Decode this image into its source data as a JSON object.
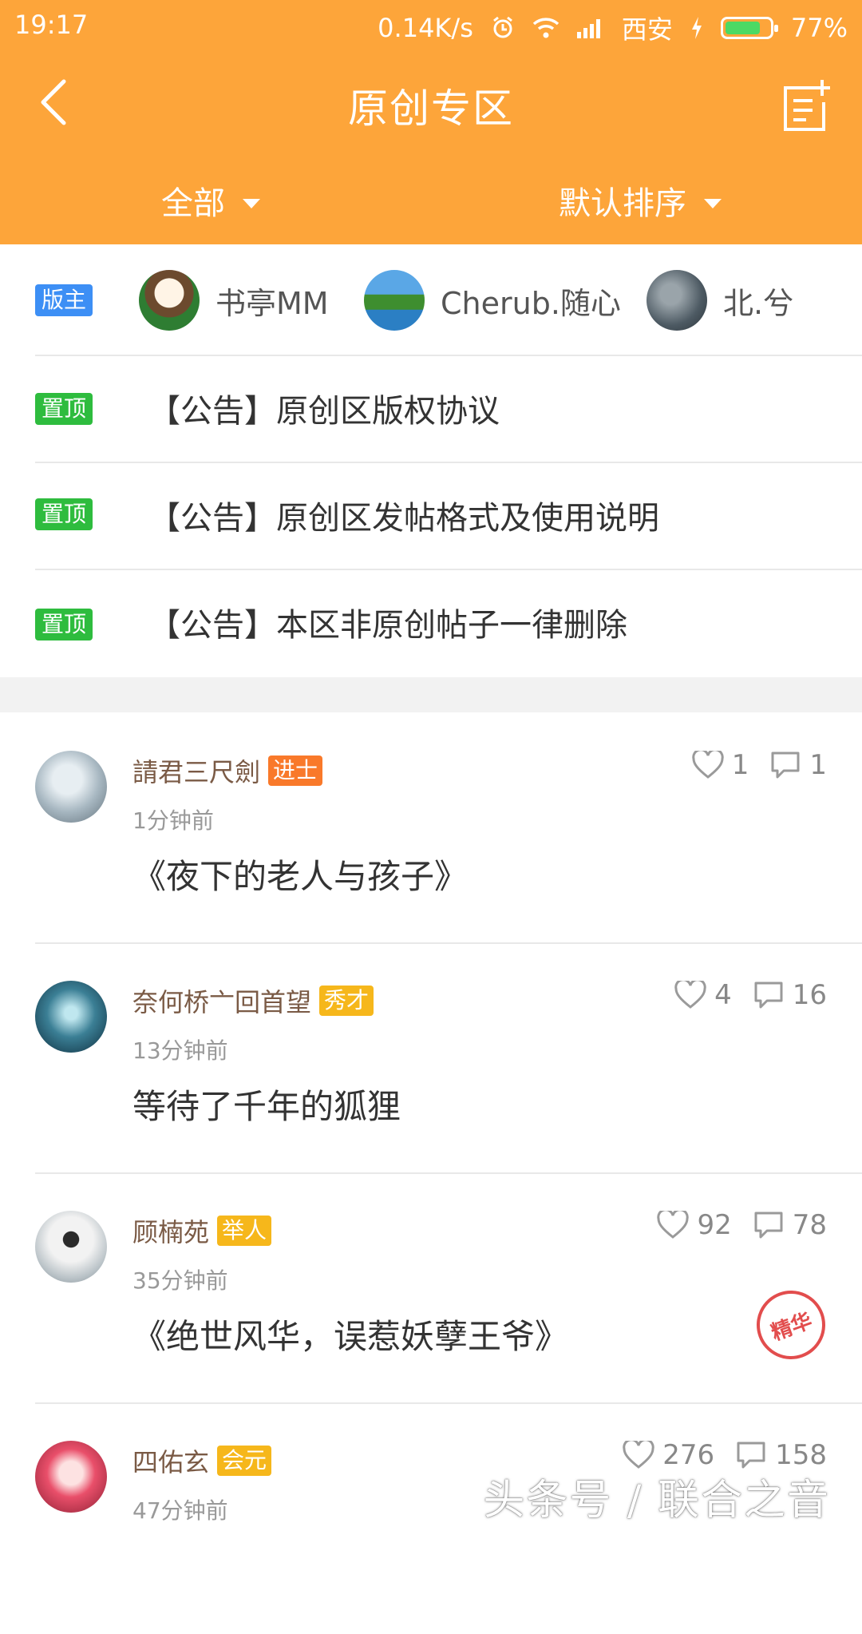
{
  "status_bar": {
    "time": "19:17",
    "speed": "0.14K/s",
    "location": "西安",
    "battery": "77%"
  },
  "header": {
    "title": "原创专区"
  },
  "filters": {
    "category": "全部",
    "sort": "默认排序"
  },
  "moderators": {
    "badge": "版主",
    "users": [
      {
        "name": "书亭MM"
      },
      {
        "name": "Cherub.随心"
      },
      {
        "name": "北.兮"
      }
    ]
  },
  "pinned": {
    "badge": "置顶",
    "items": [
      {
        "title": "【公告】原创区版权协议"
      },
      {
        "title": "【公告】原创区发帖格式及使用说明"
      },
      {
        "title": "【公告】本区非原创帖子一律删除"
      }
    ]
  },
  "posts": [
    {
      "user": "請君三尺劍",
      "rank": "进士",
      "time": "1分钟前",
      "title": "《夜下的老人与孩子》",
      "likes": "1",
      "comments": "1"
    },
    {
      "user": "奈何桥亠回首望",
      "rank": "秀才",
      "time": "13分钟前",
      "title": "等待了千年的狐狸",
      "likes": "4",
      "comments": "16"
    },
    {
      "user": "顾楠苑",
      "rank": "举人",
      "time": "35分钟前",
      "title": "《绝世风华，误惹妖孽王爷》",
      "likes": "92",
      "comments": "78",
      "stamp": "精华"
    },
    {
      "user": "四佑玄",
      "rank": "会元",
      "time": "47分钟前",
      "likes": "276",
      "comments": "158"
    }
  ],
  "watermark": "头条号 / 联合之音",
  "colors": {
    "header": "#fda53a",
    "mod_badge": "#3d8ff5",
    "pin_badge": "#2ebc3e",
    "rank_orange": "#f9792a",
    "rank_yellow": "#f6b71b"
  }
}
